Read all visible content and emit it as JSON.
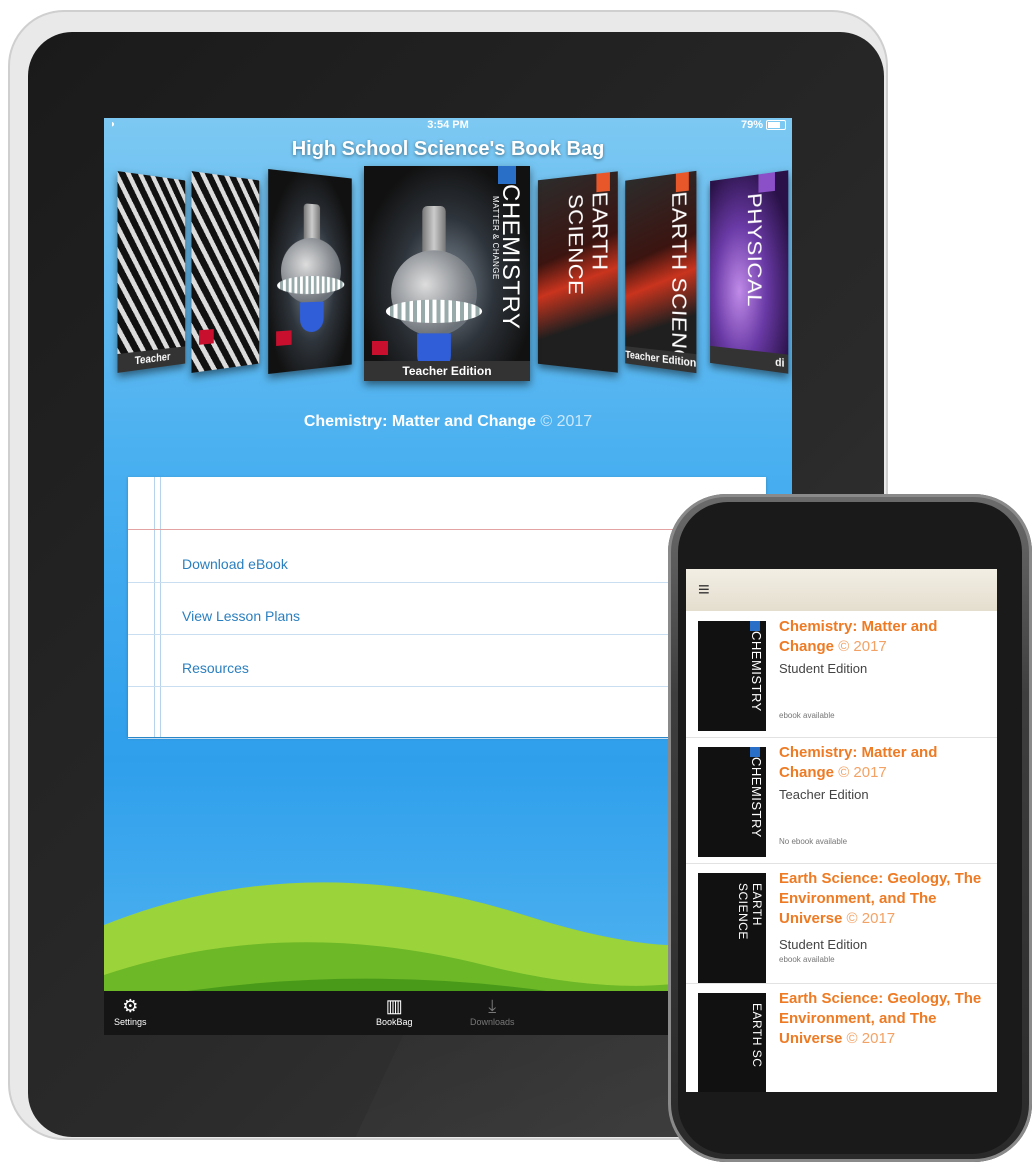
{
  "tablet": {
    "status": {
      "time": "3:54 PM",
      "battery": "79%"
    },
    "app_title": "High School Science's Book Bag",
    "carousel": [
      {
        "edition": "Teacher Edition",
        "style": "zebra"
      },
      {
        "edition": "",
        "style": "zebra"
      },
      {
        "edition": "",
        "style": "flask"
      },
      {
        "title": "CHEMISTRY",
        "subtitle": "MATTER & CHANGE",
        "edition": "Teacher Edition",
        "style": "flask",
        "featured": true
      },
      {
        "title": "EARTH SCIENCE",
        "edition": "",
        "style": "earth"
      },
      {
        "title": "EARTH SCIENC",
        "edition": "Teacher Edition",
        "style": "earth"
      },
      {
        "title": "PHYSICAL",
        "edition": "di",
        "style": "physical"
      }
    ],
    "featured_book": "Chemistry: Matter and Change",
    "featured_year": "© 2017",
    "menu": [
      "Download eBook",
      "View Lesson Plans",
      "Resources"
    ],
    "tabs": {
      "settings": "Settings",
      "bookbag": "BookBag",
      "downloads": "Downloads"
    },
    "colors": {
      "sky_top": "#7cc8f2",
      "sky_mid": "#2f9fec",
      "link": "#2a7fbf",
      "tabbar": "#151515"
    }
  },
  "phone": {
    "items": [
      {
        "title": "Chemistry: Matter and Change",
        "year": "© 2017",
        "edition": "Student Edition",
        "availability": "ebook available",
        "cover": "CHEMISTRY"
      },
      {
        "title": "Chemistry: Matter and Change",
        "year": "© 2017",
        "edition": "Teacher Edition",
        "availability": "No ebook available",
        "cover": "CHEMISTRY"
      },
      {
        "title": "Earth Science: Geology, The Environment, and The Universe",
        "year": "© 2017",
        "edition": "Student Edition",
        "availability": "ebook available",
        "cover": "EARTH SCIENCE"
      },
      {
        "title": "Earth Science: Geology, The Environment, and The Universe",
        "year": "© 2017",
        "edition": "",
        "availability": "",
        "cover": "EARTH SC"
      }
    ],
    "colors": {
      "title": "#ee7b24",
      "header": "#efeadf"
    }
  }
}
